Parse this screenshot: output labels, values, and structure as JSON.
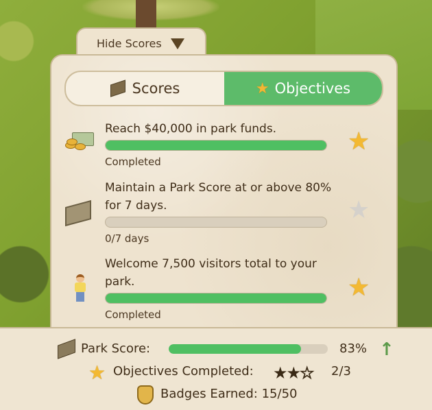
{
  "toggle": {
    "label": "Hide Scores"
  },
  "tabs": [
    {
      "label": "Scores",
      "active": false
    },
    {
      "label": "Objectives",
      "active": true
    }
  ],
  "objectives": [
    {
      "title": "Reach $40,000 in park funds.",
      "progress": 1.0,
      "status": "Completed",
      "star": "earned",
      "icon": "money-icon"
    },
    {
      "title": "Maintain a Park Score at or above 80% for 7 days.",
      "progress": 0.0,
      "status": "0/7 days",
      "star": "unearned",
      "icon": "sign-icon"
    },
    {
      "title": "Welcome 7,500 visitors total to your park.",
      "progress": 1.0,
      "status": "Completed",
      "star": "earned",
      "icon": "visitor-icon"
    }
  ],
  "footer": {
    "park_score_label": "Park Score:",
    "park_score_value": "83%",
    "park_score_fraction": 0.83,
    "objectives_label": "Objectives Completed:",
    "objectives_stars": {
      "earned": 2,
      "total": 3
    },
    "objectives_value": "2/3",
    "badges_label": "Badges Earned:",
    "badges_value": "15/50"
  },
  "colors": {
    "accent_green": "#5dbb6a",
    "progress_fill": "#4fbf62",
    "star_gold": "#f3b933",
    "panel_bg": "#eee3cf"
  }
}
